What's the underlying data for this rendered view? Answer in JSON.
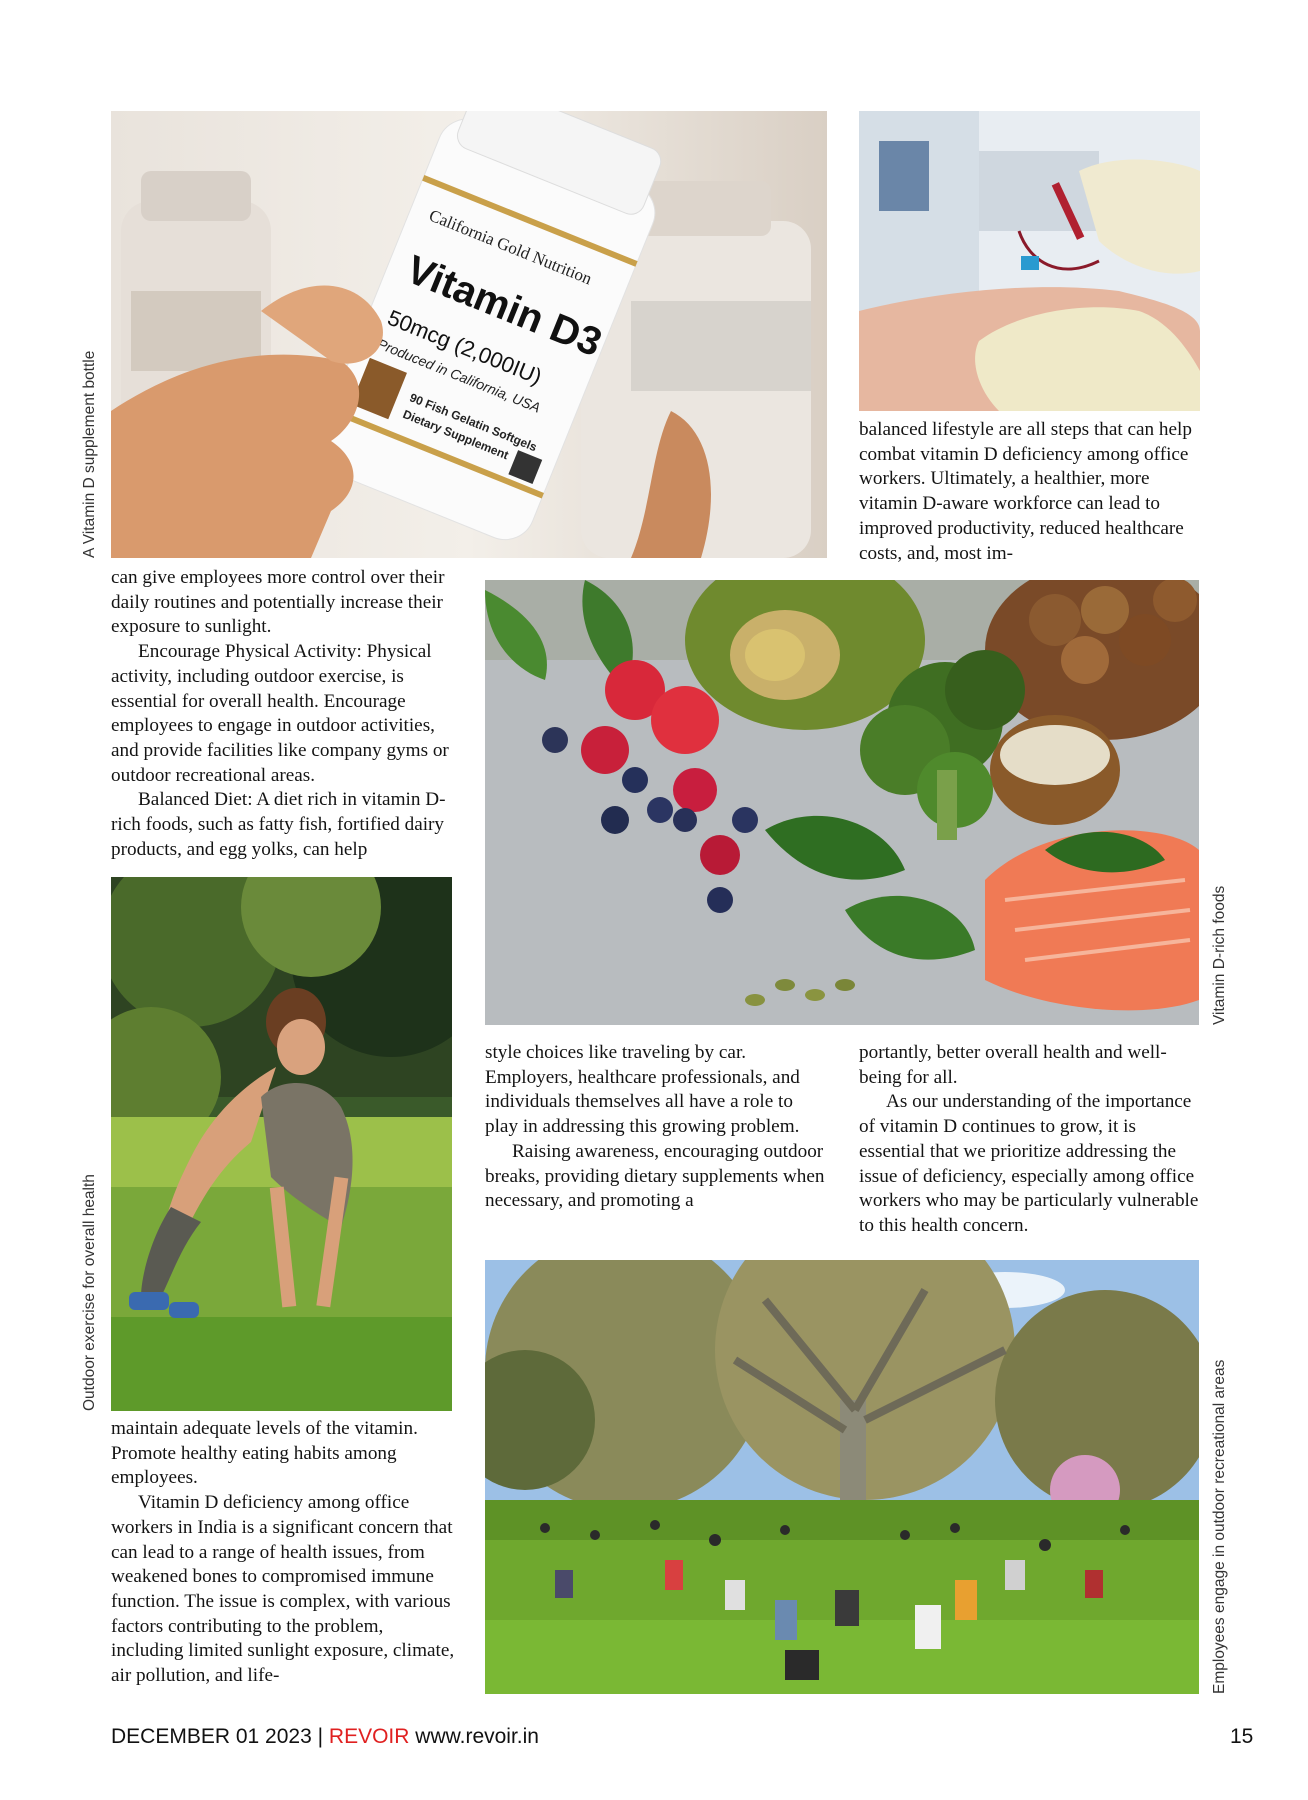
{
  "captions": {
    "bottle": "A Vitamin D supplement bottle",
    "foods": "Vitamin D-rich foods",
    "exercise": "Outdoor exercise for overall health",
    "park": "Employees engage in outdoor recreational areas"
  },
  "bottle_label": {
    "brand": "California Gold Nutrition",
    "product": "Vitamin D3",
    "dose": "50mcg (2,000IU)",
    "origin": "Produced in California, USA",
    "count": "90 Fish Gelatin Softgels",
    "type": "Dietary Supplement"
  },
  "col_left_top": [
    "can give employees more control over their daily routines and potentially increase their exposure to sunlight.",
    "Encourage Physical Activity: Physical activity, including outdoor exercise, is essential for overall health. Encourage employees to engage in outdoor activities, and provide facilities like company gyms or outdoor recreational areas.",
    "Balanced Diet: A diet rich in vitamin D-rich foods, such as fatty fish, fortified dairy products, and egg yolks, can help"
  ],
  "col_left_bottom": [
    "maintain adequate levels of the vitamin. Promote healthy eating habits among employees.",
    "Vitamin D deficiency among office workers in India is a significant concern that can lead to a range of health issues, from weakened bones to compromised immune function. The issue is complex, with various factors contributing to the problem, including limited sunlight exposure, climate, air pollution, and life-"
  ],
  "col_mid": [
    "style choices like traveling by car. Employers, healthcare professionals, and individuals themselves all have a role to play in addressing this growing problem.",
    "Raising awareness, encouraging outdoor breaks, providing dietary supplements when necessary, and promoting a"
  ],
  "col_right_top": [
    "balanced lifestyle are all steps that can help combat vitamin D deficiency among office workers. Ultimately, a healthier, more vitamin D-aware workforce can lead to improved productivity, reduced healthcare costs, and, most im-"
  ],
  "col_right_bottom": [
    "portantly, better overall health and well-being for all.",
    "As our understanding of the importance of vitamin D continues to grow, it is essential that we prioritize addressing the issue of deficiency, especially among office workers who may be particularly vulnerable to this health concern."
  ],
  "footer": {
    "date": "DECEMBER 01 2023",
    "separator": "|",
    "brand": "REVOIR",
    "url": "www.revoir.in",
    "page_number": "15"
  }
}
